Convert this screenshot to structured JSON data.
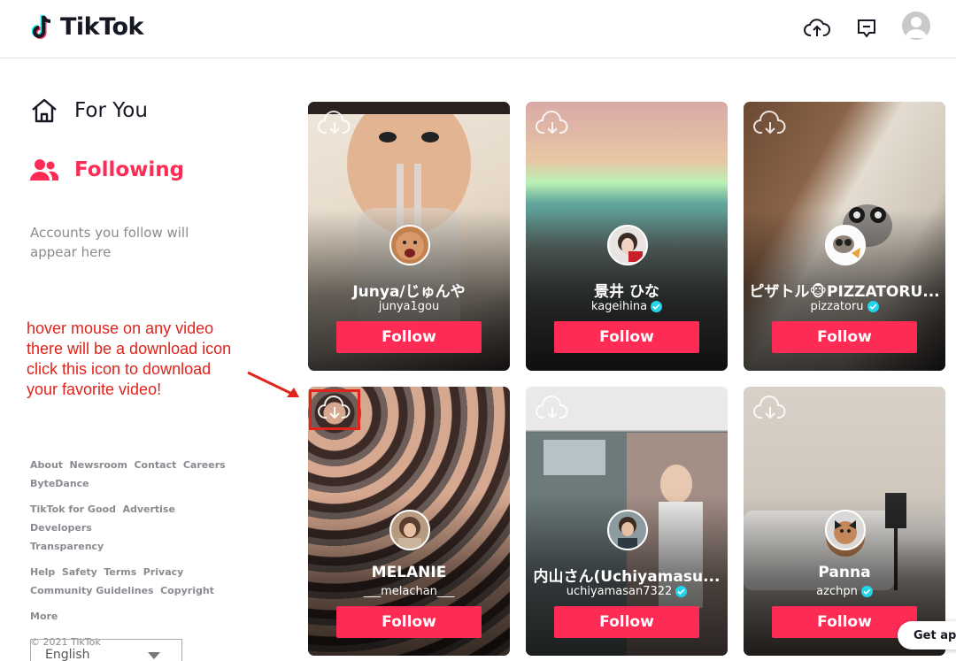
{
  "header": {
    "brand": "TikTok"
  },
  "sidebar": {
    "nav": [
      {
        "label": "For You",
        "icon": "home-icon"
      },
      {
        "label": "Following",
        "icon": "people-icon",
        "active": true
      }
    ],
    "hint": "Accounts you follow will appear here"
  },
  "annotation": {
    "lines": [
      "hover mouse on any video",
      "there will be a download icon",
      "click this icon to download",
      "your favorite video!"
    ]
  },
  "footer": {
    "groups": [
      [
        "About",
        "Newsroom",
        "Contact",
        "Careers",
        "ByteDance"
      ],
      [
        "TikTok for Good",
        "Advertise",
        "Developers",
        "Transparency"
      ],
      [
        "Help",
        "Safety",
        "Terms",
        "Privacy",
        "Community Guidelines",
        "Copyright"
      ],
      [
        "More"
      ]
    ],
    "copyright": "© 2021 TikTok",
    "language": "English"
  },
  "cards": [
    {
      "name": "Junya/じゅんや",
      "username": "junya1gou",
      "verified": false,
      "follow": "Follow"
    },
    {
      "name": "景井 ひな",
      "username": "kageihina",
      "verified": true,
      "follow": "Follow"
    },
    {
      "name": "ピザトル🐵PIZZATORU...",
      "username": "pizzatoru",
      "verified": true,
      "follow": "Follow"
    },
    {
      "name": "MELANIE",
      "username": "___melachan___",
      "verified": false,
      "follow": "Follow"
    },
    {
      "name": "内山さん(Uchiyamasu...",
      "username": "uchiyamasan7322",
      "verified": true,
      "follow": "Follow"
    },
    {
      "name": "Panna",
      "username": "azchpn",
      "verified": true,
      "follow": "Follow"
    }
  ],
  "get_app": "Get app",
  "colors": {
    "accent": "#fe2c55",
    "annotation": "#e0231b",
    "verified": "#20d5ec"
  }
}
